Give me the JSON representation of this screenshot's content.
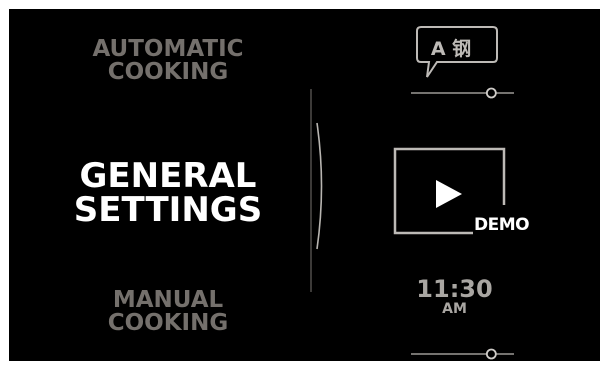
{
  "menu": {
    "automatic_cooking": [
      "AUTOMATIC",
      "COOKING"
    ],
    "general_settings": [
      "GENERAL",
      "SETTINGS"
    ],
    "manual_cooking": [
      "MANUAL",
      "COOKING"
    ]
  },
  "language": {
    "label": "A 钢",
    "slider_level": 0.78
  },
  "demo": {
    "label": "DEMO",
    "icon": "play-icon"
  },
  "clock": {
    "time": "11:30",
    "ampm": "AM",
    "slider_level": 0.78
  },
  "colors": {
    "background": "#000000",
    "active_text": "#ffffff",
    "inactive_text": "#74706c",
    "icon_gray": "#a9a6a2"
  }
}
